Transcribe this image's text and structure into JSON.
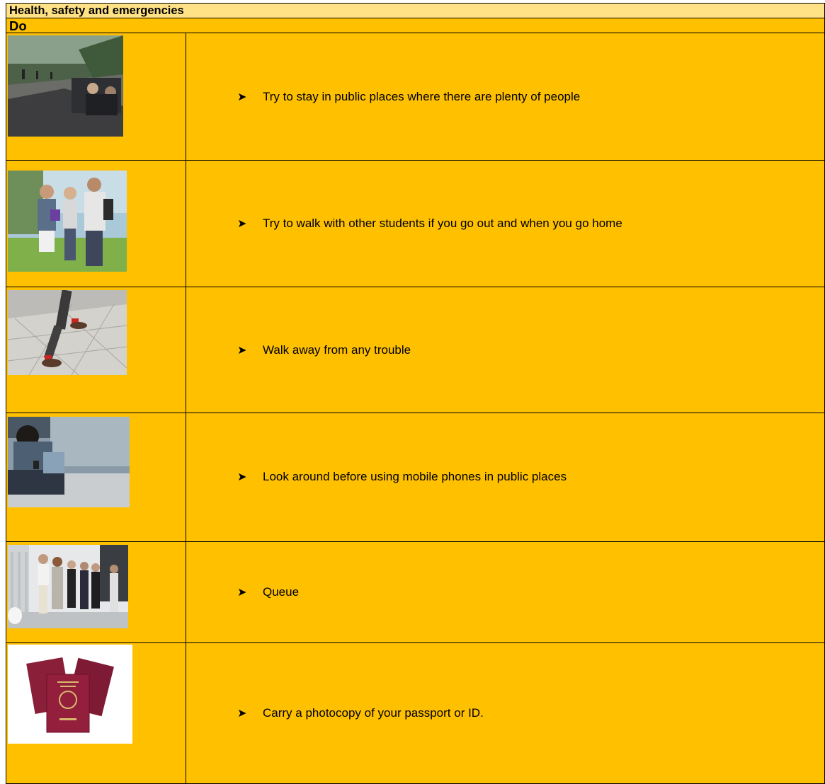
{
  "header": {
    "title": "Health, safety and emergencies",
    "subtitle": "Do"
  },
  "rows": [
    {
      "text": "Try to stay in public places where there are plenty of people",
      "photo": "park-crowd-photo"
    },
    {
      "text": "Try to walk with other students if you go out and when you go home",
      "photo": "students-walking-photo"
    },
    {
      "text": "Walk away from any trouble",
      "photo": "walking-legs-photo"
    },
    {
      "text": "Look around before using mobile phones in public places",
      "photo": "phone-user-photo"
    },
    {
      "text": "Queue",
      "photo": "queue-photo"
    },
    {
      "text": "Carry a photocopy of your passport or ID.",
      "photo": "passports-photo"
    }
  ],
  "bullet_icon": "arrow-bullet-icon",
  "colors": {
    "title_bg": "#FFE285",
    "row_bg": "#FFC000",
    "border": "#000000"
  }
}
